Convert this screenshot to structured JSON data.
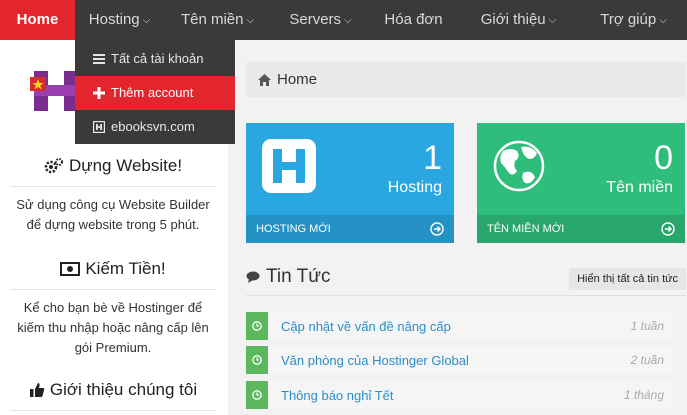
{
  "nav": {
    "items": [
      {
        "label": "Home",
        "caret": false
      },
      {
        "label": "Hosting",
        "caret": true
      },
      {
        "label": "Tên miền",
        "caret": true
      },
      {
        "label": "Servers",
        "caret": true
      },
      {
        "label": "Hóa đơn",
        "caret": false
      },
      {
        "label": "Giới thiệu",
        "caret": true
      },
      {
        "label": "Trợ giúp",
        "caret": true
      }
    ]
  },
  "dropdown": {
    "items": [
      {
        "label": "Tất cả tài khoản",
        "icon": "list-icon"
      },
      {
        "label": "Thêm account",
        "icon": "plus-icon"
      },
      {
        "label": "ebooksvn.com",
        "icon": "hosting-icon"
      }
    ]
  },
  "sidebar": {
    "blocks": [
      {
        "title": "Dựng Website!",
        "icon": "cogs-icon",
        "text": "Sử dụng công cụ Website Builder để dựng website trong 5 phút."
      },
      {
        "title": "Kiếm Tiền!",
        "icon": "money-icon",
        "text": "Kể cho bạn bè về Hostinger để kiếm thu nhập hoặc nâng cấp lên gói Premium."
      },
      {
        "title": "Giới thiệu chúng tôi",
        "icon": "thumbs-up-icon",
        "text": ""
      }
    ]
  },
  "breadcrumb": {
    "label": "Home"
  },
  "tiles": {
    "hosting": {
      "count": "1",
      "label": "Hosting",
      "footer": "HOSTING MỚI"
    },
    "domains": {
      "count": "0",
      "label": "Tên miền",
      "footer": "TÊN MIỀN MỚI"
    }
  },
  "news": {
    "title": "Tin Tức",
    "show_all": "Hiển thị tất cả tin tức",
    "items": [
      {
        "text": "Cập nhật về vấn đề nâng cấp",
        "time": "1 tuần"
      },
      {
        "text": "Văn phòng của Hostinger Global",
        "time": "2 tuần"
      },
      {
        "text": "Thông báo nghỉ Tết",
        "time": "1 tháng"
      }
    ]
  },
  "colors": {
    "brand_red": "#e3262d",
    "nav_bg": "#3a3a3a",
    "tile_blue": "#2aa7e1",
    "tile_green": "#2fbd7c",
    "news_green": "#5cb85c"
  }
}
